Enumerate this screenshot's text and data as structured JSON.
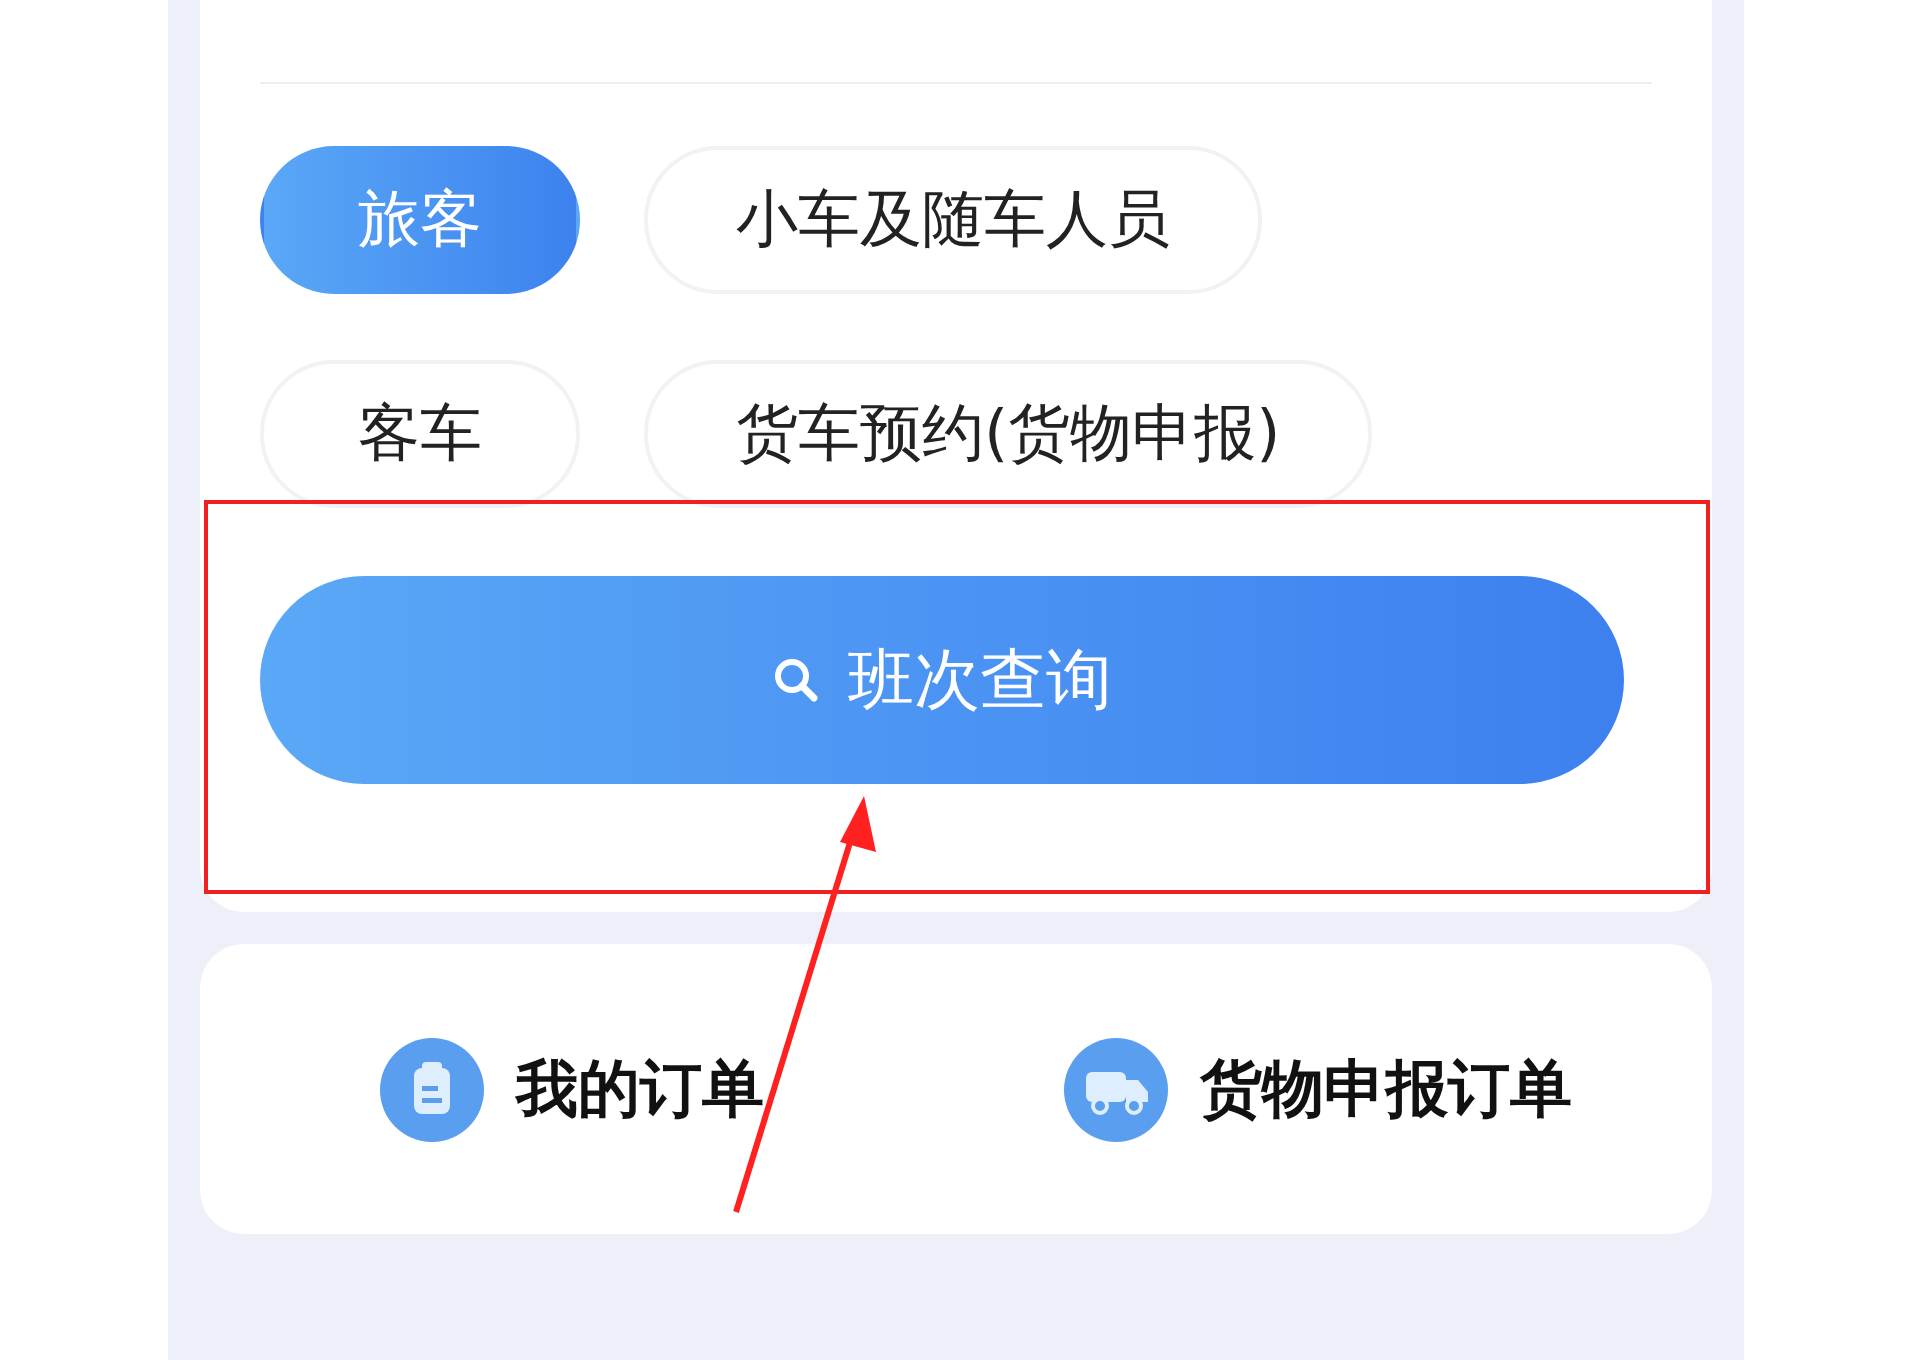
{
  "ticket_types": [
    {
      "label": "旅客",
      "selected": true
    },
    {
      "label": "小车及随车人员",
      "selected": false
    },
    {
      "label": "客车",
      "selected": false
    },
    {
      "label": "货车预约(货物申报)",
      "selected": false
    }
  ],
  "search_button": {
    "label": "班次查询"
  },
  "shortcuts": [
    {
      "label": "我的订单",
      "kind": "clipboard"
    },
    {
      "label": "货物申报订单",
      "kind": "truck"
    }
  ]
}
